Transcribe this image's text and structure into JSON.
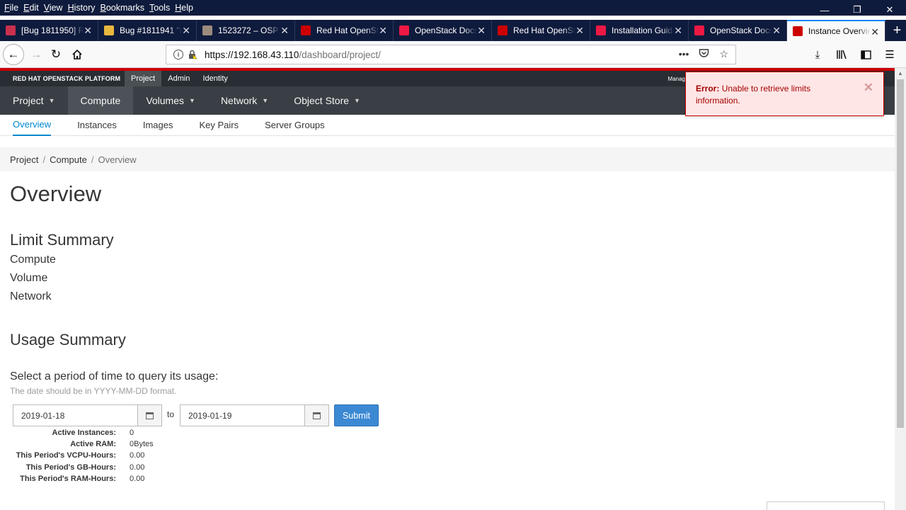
{
  "browser": {
    "menu": [
      "File",
      "Edit",
      "View",
      "History",
      "Bookmarks",
      "Tools",
      "Help"
    ],
    "window_controls": {
      "minimize": "—",
      "restore": "❐",
      "close": "✕"
    },
    "tabs": [
      {
        "title": "[Bug 1811950] Re",
        "favicon_color": "#c9304e",
        "icon": "bug-icon"
      },
      {
        "title": "Bug #1811941 \"n",
        "favicon_color": "#e9b83f",
        "icon": "launchpad-icon"
      },
      {
        "title": "1523272 – OSP10",
        "favicon_color": "#9b8b7e",
        "icon": "bugzilla-icon"
      },
      {
        "title": "Red Hat OpenSt",
        "favicon_color": "#cc0000",
        "icon": "redhat-icon"
      },
      {
        "title": "OpenStack Docs:",
        "favicon_color": "#ed1944",
        "icon": "openstack-icon"
      },
      {
        "title": "Red Hat OpenSt",
        "favicon_color": "#cc0000",
        "icon": "redhat-icon"
      },
      {
        "title": "Installation Guid",
        "favicon_color": "#ed1944",
        "icon": "openstack-icon"
      },
      {
        "title": "OpenStack Docs:",
        "favicon_color": "#ed1944",
        "icon": "openstack-icon"
      },
      {
        "title": "Instance Overvie",
        "favicon_color": "#cc0000",
        "icon": "redhat-icon",
        "active": true
      }
    ],
    "url_host": "https://192.168.43.110",
    "url_path": "/dashboard/project/"
  },
  "app": {
    "brand": "RED HAT OPENSTACK PLATFORM",
    "context_tabs": [
      "Project",
      "Admin",
      "Identity"
    ],
    "user_menu_partial": "Manag",
    "primary_nav": [
      {
        "label": "Project",
        "dropdown": true
      },
      {
        "label": "Compute",
        "dropdown": false,
        "active": true
      },
      {
        "label": "Volumes",
        "dropdown": true
      },
      {
        "label": "Network",
        "dropdown": true
      },
      {
        "label": "Object Store",
        "dropdown": true
      }
    ],
    "secondary_nav": [
      "Overview",
      "Instances",
      "Images",
      "Key Pairs",
      "Server Groups"
    ],
    "breadcrumb": [
      "Project",
      "Compute",
      "Overview"
    ]
  },
  "main": {
    "title": "Overview",
    "limit_summary": {
      "heading": "Limit Summary",
      "items": [
        "Compute",
        "Volume",
        "Network"
      ]
    },
    "usage_summary": {
      "heading": "Usage Summary",
      "period_label": "Select a period of time to query its usage:",
      "help": "The date should be in YYYY-MM-DD format.",
      "start_date": "2019-01-18",
      "to_label": "to",
      "end_date": "2019-01-19",
      "submit_label": "Submit",
      "stats": [
        {
          "label": "Active Instances:",
          "value": "0"
        },
        {
          "label": "Active RAM:",
          "value": "0Bytes"
        },
        {
          "label": "This Period's VCPU-Hours:",
          "value": "0.00"
        },
        {
          "label": "This Period's GB-Hours:",
          "value": "0.00"
        },
        {
          "label": "This Period's RAM-Hours:",
          "value": "0.00"
        }
      ]
    }
  },
  "toast": {
    "prefix": "Error:",
    "message": "Unable to retrieve limits information."
  }
}
